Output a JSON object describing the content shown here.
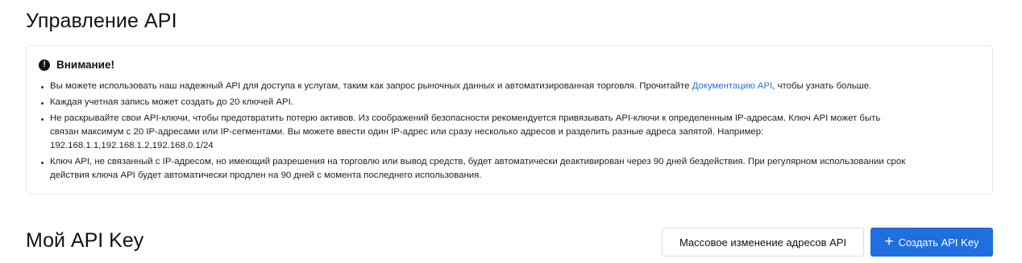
{
  "page": {
    "title": "Управление API"
  },
  "notice": {
    "icon": "exclamation-circle-icon",
    "title": "Внимание!",
    "items": [
      {
        "before": "Вы можете использовать наш надежный API для доступа к услугам, таким как запрос рыночных данных и автоматизированная торговля. Прочитайте ",
        "link": "Документацию API",
        "after": ", чтобы узнать больше."
      },
      {
        "text": "Каждая учетная запись может создать до 20 ключей API."
      },
      {
        "line1": "Не раскрывайте свои API-ключи, чтобы предотвратить потерю активов. Из соображений безопасности рекомендуется привязывать API-ключи к определенным IP-адресам. Ключ API может быть",
        "line2": "связан максимум с 20 IP-адресами или IP-сегментами. Вы можете ввести один IP-адрес или сразу несколько адресов и разделить разные адреса запятой. Например:",
        "line3": "192.168.1.1,192.168.1.2,192.168.0.1/24"
      },
      {
        "line1": "Ключ API, не связанный с IP-адресом, но имеющий разрешения на торговлю или вывод средств, будет автоматически деактивирован через 90 дней бездействия. При регулярном использовании срок",
        "line2": "действия ключа API будет автоматически продлен на 90 дней с момента последнего использования."
      }
    ]
  },
  "section": {
    "title": "Мой API Key"
  },
  "actions": {
    "bulk_edit_label": "Массовое изменение адресов API",
    "create_label": "Создать API Key",
    "create_icon": "plus-icon"
  },
  "colors": {
    "primary": "#1f6fe0",
    "link": "#2a73c8",
    "border": "#e6e8ea"
  }
}
